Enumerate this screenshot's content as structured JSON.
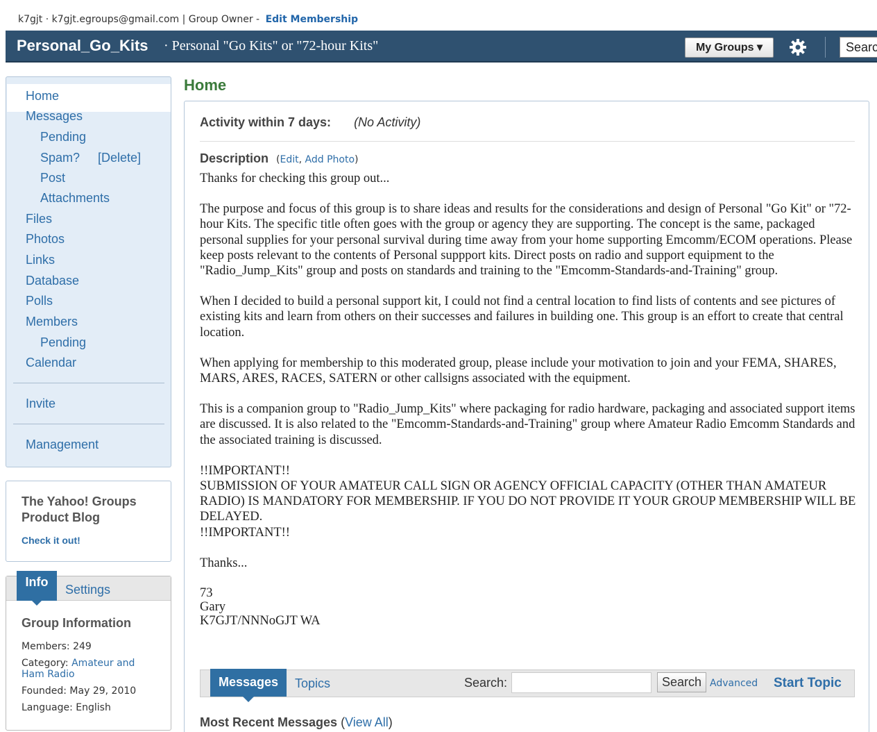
{
  "userbar": {
    "user": "k7gjt",
    "email": "k7gjt.egroups@gmail.com",
    "role": "Group Owner",
    "edit_membership": "Edit Membership"
  },
  "header": {
    "group_name": "Personal_Go_Kits",
    "group_description": "· Personal \"Go Kits\" or \"72-hour Kits\"",
    "my_groups": "My Groups ▾",
    "search_placeholder": "Searc"
  },
  "sidebar": {
    "items": [
      {
        "label": "Home"
      },
      {
        "label": "Messages"
      },
      {
        "label": "Pending"
      },
      {
        "label": "Spam?"
      },
      {
        "label": "[Delete]"
      },
      {
        "label": "Post"
      },
      {
        "label": "Attachments"
      },
      {
        "label": "Files"
      },
      {
        "label": "Photos"
      },
      {
        "label": "Links"
      },
      {
        "label": "Database"
      },
      {
        "label": "Polls"
      },
      {
        "label": "Members"
      },
      {
        "label": "Pending"
      },
      {
        "label": "Calendar"
      },
      {
        "label": "Invite"
      },
      {
        "label": "Management"
      }
    ]
  },
  "blog": {
    "title": "The Yahoo! Groups Product Blog",
    "link": "Check it out!"
  },
  "info_panel": {
    "tab_info": "Info",
    "tab_settings": "Settings",
    "heading": "Group Information",
    "members_label": "Members:",
    "members_value": "249",
    "category_label": "Category:",
    "category_value": "Amateur and Ham Radio",
    "founded_label": "Founded:",
    "founded_value": "May 29, 2010",
    "language_label": "Language:",
    "language_value": "English"
  },
  "main": {
    "page_title": "Home",
    "activity_label": "Activity within 7 days:",
    "activity_value": "(No Activity)",
    "description_label": "Description",
    "edit_link": "Edit",
    "add_photo_link": "Add Photo",
    "paragraphs": [
      "Thanks for checking this group out...",
      "The purpose and focus of this group is to share ideas and results for the considerations and design of Personal \"Go Kit\" or \"72-hour Kits. The specific title often goes with the group or agency they are supporting. The concept is the same, packaged personal supplies for your personal survival during time away from your home supporting Emcomm/ECOM operations. Please keep posts relevant to the contents of Personal suppport kits. Direct posts on radio and support equipment to the \"Radio_Jump_Kits\" group and posts on standards and training to the \"Emcomm-Standards-and-Training\" group.",
      "When I decided to build a personal support kit, I could not find a central location to find lists of contents and see pictures of existing kits and learn from others on their successes and failures in building one. This group is an effort to create that central location.",
      "When applying for membership to this moderated group, please include your motivation to join and your FEMA, SHARES, MARS, ARES, RACES, SATERN or other callsigns associated with the equipment.",
      "This is a companion group to \"Radio_Jump_Kits\" where packaging for radio hardware, packaging and associated support items are discussed. It is also related to the \"Emcomm-Standards-and-Training\" group where Amateur Radio Emcomm Standards and the associated training is discussed.",
      "!!IMPORTANT!!\nSUBMISSION OF YOUR AMATEUR CALL SIGN OR AGENCY OFFICIAL CAPACITY (OTHER THAN AMATEUR RADIO) IS MANDATORY FOR MEMBERSHIP. IF YOU DO NOT PROVIDE IT YOUR GROUP MEMBERSHIP WILL BE DELAYED.\n!!IMPORTANT!!",
      "Thanks..."
    ],
    "signature": "73\nGary\nK7GJT/NNNoGJT WA"
  },
  "messages_bar": {
    "tab_messages": "Messages",
    "tab_topics": "Topics",
    "search_label": "Search:",
    "search_button": "Search",
    "advanced": "Advanced",
    "start_topic": "Start Topic"
  },
  "recent": {
    "label": "Most Recent Messages",
    "view_all": "View All"
  }
}
